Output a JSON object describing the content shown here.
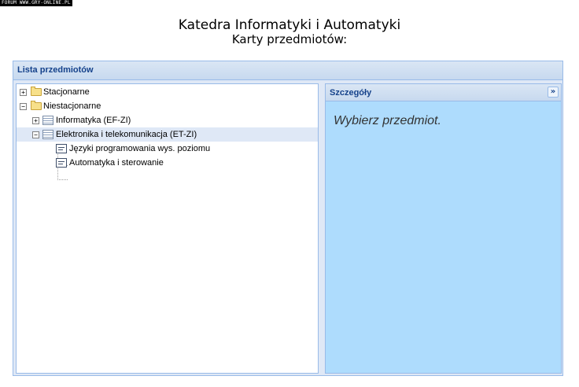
{
  "watermark": "FORUM WWW.GRY-ONLINE.PL",
  "header": {
    "title": "Katedra Informatyki i Automatyki",
    "subtitle": "Karty przedmiotów:"
  },
  "main_panel": {
    "title": "Lista przedmiotów"
  },
  "tree": {
    "nodes": [
      {
        "label": "Stacjonarne",
        "type": "folder",
        "expander": "+",
        "expanded": false
      },
      {
        "label": "Niestacjonarne",
        "type": "folder",
        "expander": "−",
        "expanded": true
      },
      {
        "label": "Informatyka (EF-ZI)",
        "type": "list",
        "expander": "+",
        "expanded": false
      },
      {
        "label": "Elektronika i telekomunikacja (ET-ZI)",
        "type": "list",
        "expander": "−",
        "expanded": true,
        "selected": true
      },
      {
        "label": "Języki programowania wys. poziomu",
        "type": "leaf"
      },
      {
        "label": "Automatyka i sterowanie",
        "type": "leaf"
      }
    ]
  },
  "details": {
    "title": "Szczegóły",
    "collapse_symbol": "»",
    "message": "Wybierz przedmiot."
  }
}
